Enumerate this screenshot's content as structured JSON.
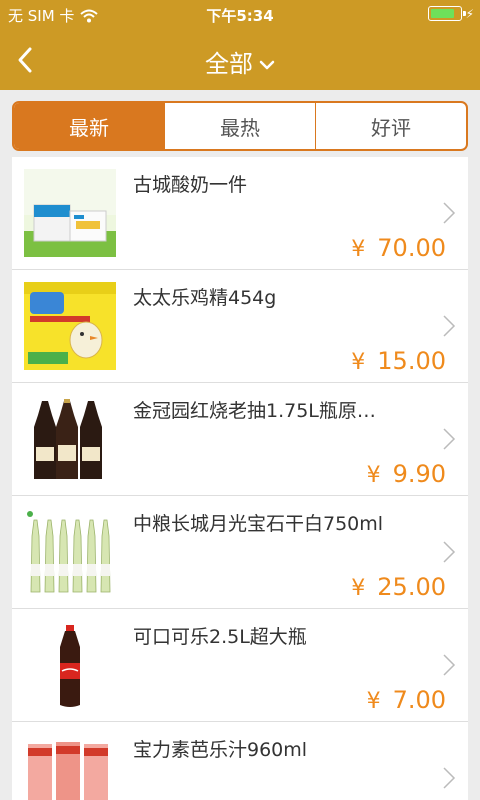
{
  "status_bar": {
    "carrier": "无 SIM 卡",
    "time": "下午5:34",
    "battery_level": 0.85
  },
  "nav": {
    "title": "全部",
    "back_icon": "chevron-left-icon",
    "dropdown_icon": "chevron-down-icon"
  },
  "tabs": [
    {
      "label": "最新",
      "selected": true
    },
    {
      "label": "最热",
      "selected": false
    },
    {
      "label": "好评",
      "selected": false
    }
  ],
  "products": [
    {
      "name": "古城酸奶一件",
      "currency": "¥",
      "price": "70.00"
    },
    {
      "name": "太太乐鸡精454g",
      "currency": "¥",
      "price": "15.00"
    },
    {
      "name": "金冠园红烧老抽1.75L瓶原…",
      "currency": "¥",
      "price": "9.90"
    },
    {
      "name": "中粮长城月光宝石干白750ml",
      "currency": "¥",
      "price": "25.00"
    },
    {
      "name": "可口可乐2.5L超大瓶",
      "currency": "¥",
      "price": "7.00"
    },
    {
      "name": "宝力素芭乐汁960ml",
      "currency": "¥",
      "price": ""
    }
  ],
  "colors": {
    "header": "#cd9a25",
    "accent": "#d9781f",
    "price": "#ef8a1c"
  }
}
